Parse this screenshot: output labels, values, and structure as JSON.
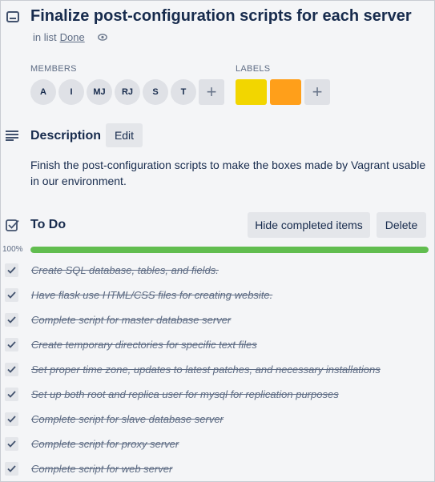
{
  "card": {
    "title": "Finalize post-configuration scripts for each server",
    "in_list_prefix": "in list",
    "list_name": "Done"
  },
  "members": {
    "heading": "MEMBERS",
    "avatars": [
      "A",
      "I",
      "MJ",
      "RJ",
      "S",
      "T"
    ],
    "add_label": "+"
  },
  "labels": {
    "heading": "LABELS",
    "colors": [
      "#f2d600",
      "#ff9f1a"
    ],
    "add_label": "+"
  },
  "description": {
    "heading": "Description",
    "edit_label": "Edit",
    "text": "Finish the post-configuration scripts to make the boxes made by Vagrant usable in our environment."
  },
  "checklist": {
    "heading": "To Do",
    "hide_completed_label": "Hide completed items",
    "delete_label": "Delete",
    "progress_text": "100%",
    "progress": 1.0,
    "items": [
      "Create SQL database, tables, and fields.",
      "Have flask use HTML/CSS files for creating website.",
      "Complete script for master database server",
      "Create temporary directories for specific text files",
      "Set proper time zone, updates to latest patches, and necessary installations",
      "Set up both root and replica user for mysql for replication purposes",
      "Complete script for slave database server",
      "Complete script for proxy server",
      "Complete script for web server"
    ]
  },
  "colors": {
    "progress": "#61bd4f",
    "button_bg": "#e4e6ea"
  }
}
